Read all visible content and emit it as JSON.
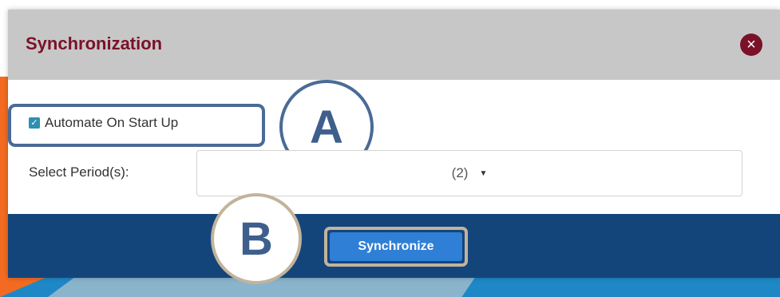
{
  "dialog": {
    "title": "Synchronization",
    "close_icon": "close-icon",
    "automate_label": "Automate On Start Up",
    "automate_checked": true,
    "period_label": "Select Period(s):",
    "period_value": "(2)",
    "synchronize_label": "Synchronize"
  },
  "callouts": {
    "a": "A",
    "b": "B"
  },
  "colors": {
    "header_bg": "#c7c7c7",
    "title": "#7b1128",
    "close_bg": "#7b1128",
    "footer_bg": "#14457a",
    "button_bg": "#2f7fd6",
    "callout_a": "#4b6a96",
    "callout_b": "#c2b39c"
  }
}
